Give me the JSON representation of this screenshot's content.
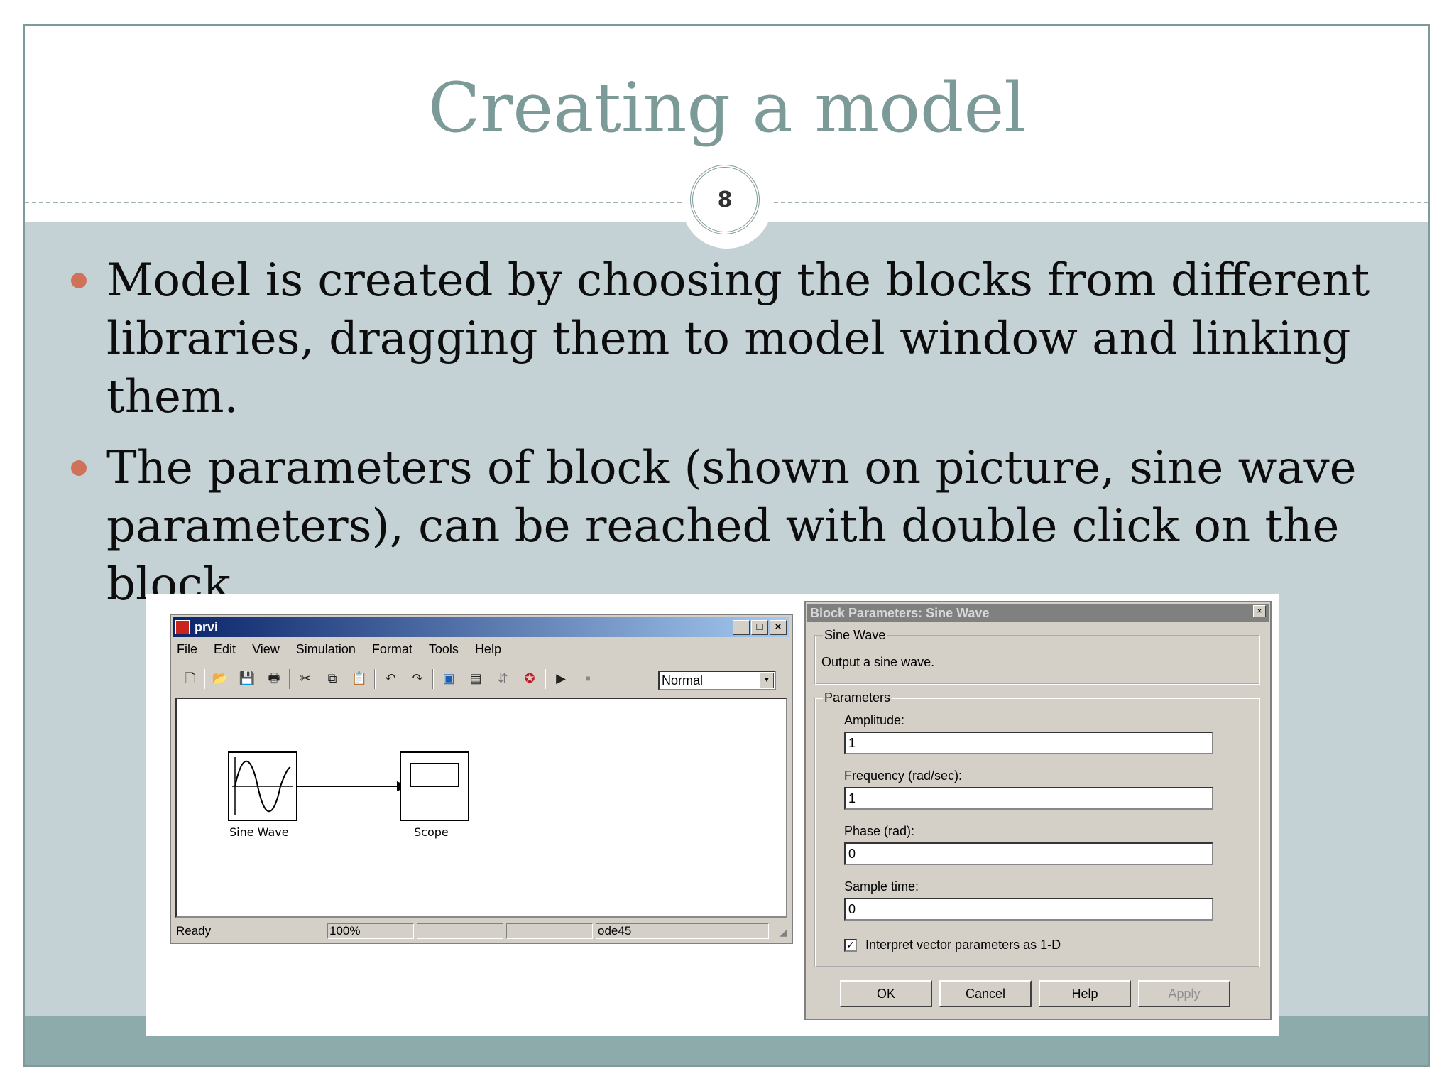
{
  "slide": {
    "title": "Creating a model",
    "slide_number": "8",
    "bullets": [
      "Model is created by choosing the blocks from different libraries, dragging them to model window and linking them.",
      "The parameters of block (shown on picture, sine wave parameters), can be reached with double click on the block."
    ]
  },
  "model_window": {
    "title": "prvi",
    "menu": [
      "File",
      "Edit",
      "View",
      "Simulation",
      "Format",
      "Tools",
      "Help"
    ],
    "toolbar_icons": [
      "new-icon",
      "open-icon",
      "save-icon",
      "print-icon",
      "cut-icon",
      "copy-icon",
      "paste-icon",
      "undo-icon",
      "redo-icon",
      "library-browser-icon",
      "model-browser-icon",
      "debug-icon",
      "build-icon",
      "start-icon",
      "stop-icon"
    ],
    "sim_mode": "Normal",
    "blocks": {
      "sine": "Sine Wave",
      "scope": "Scope"
    },
    "status": {
      "state": "Ready",
      "zoom": "100%",
      "solver": "ode45"
    }
  },
  "block_params": {
    "title": "Block Parameters: Sine Wave",
    "group_title": "Sine Wave",
    "description": "Output a sine wave.",
    "params_group": "Parameters",
    "amplitude_label": "Amplitude:",
    "amplitude": "1",
    "frequency_label": "Frequency (rad/sec):",
    "frequency": "1",
    "phase_label": "Phase (rad):",
    "phase": "0",
    "sample_label": "Sample time:",
    "sample": "0",
    "checkbox_label": "Interpret vector parameters as 1-D",
    "buttons": {
      "ok": "OK",
      "cancel": "Cancel",
      "help": "Help",
      "apply": "Apply"
    }
  }
}
